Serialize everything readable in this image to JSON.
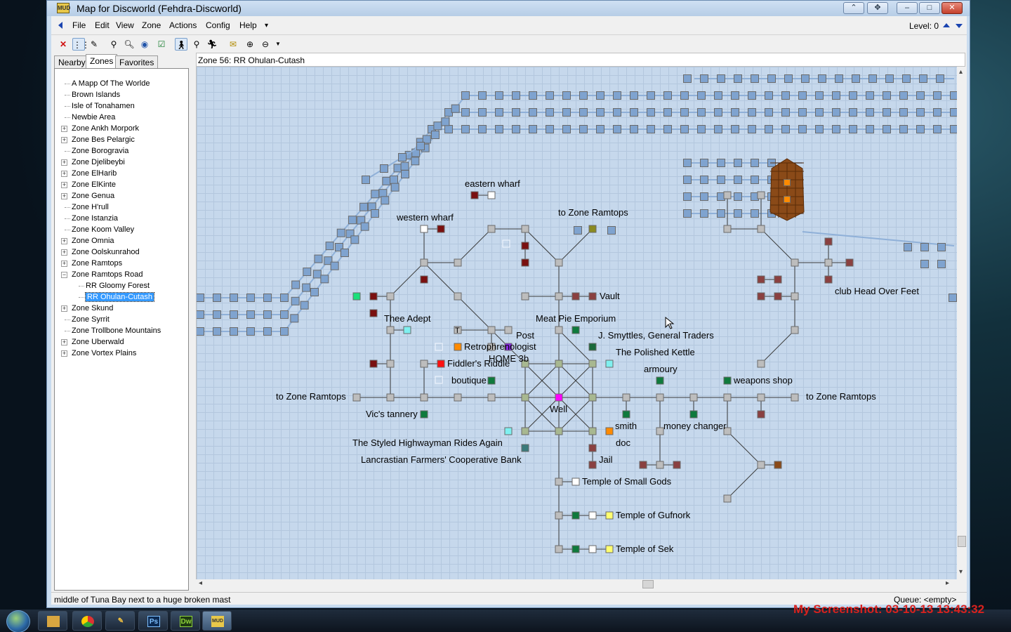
{
  "window": {
    "title": "Map for Discworld (Fehdra-Discworld)",
    "app_icon_text": "MUD"
  },
  "menu": [
    "File",
    "Edit",
    "View",
    "Zone",
    "Actions",
    "Config",
    "Help",
    "▾"
  ],
  "level": {
    "label": "Level: 0"
  },
  "panel_tabs": [
    "Nearby",
    "Zones",
    "Favorites"
  ],
  "zone_tree": [
    {
      "label": "A Mapp Of The Worlde",
      "expandable": false,
      "depth": 0
    },
    {
      "label": "Brown Islands",
      "expandable": false,
      "depth": 0
    },
    {
      "label": "Isle of Tonahamen",
      "expandable": false,
      "depth": 0
    },
    {
      "label": "Newbie Area",
      "expandable": false,
      "depth": 0
    },
    {
      "label": "Zone Ankh Morpork",
      "expandable": true,
      "depth": 0
    },
    {
      "label": "Zone Bes Pelargic",
      "expandable": true,
      "depth": 0
    },
    {
      "label": "Zone Borogravia",
      "expandable": false,
      "depth": 0
    },
    {
      "label": "Zone Djelibeybi",
      "expandable": true,
      "depth": 0
    },
    {
      "label": "Zone ElHarib",
      "expandable": true,
      "depth": 0
    },
    {
      "label": "Zone ElKinte",
      "expandable": true,
      "depth": 0
    },
    {
      "label": "Zone Genua",
      "expandable": true,
      "depth": 0
    },
    {
      "label": "Zone H'rull",
      "expandable": false,
      "depth": 0
    },
    {
      "label": "Zone Istanzia",
      "expandable": false,
      "depth": 0
    },
    {
      "label": "Zone Koom Valley",
      "expandable": false,
      "depth": 0
    },
    {
      "label": "Zone Omnia",
      "expandable": true,
      "depth": 0
    },
    {
      "label": "Zone Oolskunrahod",
      "expandable": true,
      "depth": 0
    },
    {
      "label": "Zone Ramtops",
      "expandable": true,
      "depth": 0
    },
    {
      "label": "Zone Ramtops Road",
      "expandable": true,
      "expanded": true,
      "depth": 0
    },
    {
      "label": "RR Gloomy Forest",
      "expandable": false,
      "depth": 1
    },
    {
      "label": "RR Ohulan-Cutash",
      "expandable": false,
      "depth": 1,
      "selected": true
    },
    {
      "label": "Zone Skund",
      "expandable": true,
      "depth": 0
    },
    {
      "label": "Zone Syrrit",
      "expandable": false,
      "depth": 0
    },
    {
      "label": "Zone Trollbone Mountains",
      "expandable": false,
      "depth": 0
    },
    {
      "label": "Zone Uberwald",
      "expandable": true,
      "depth": 0
    },
    {
      "label": "Zone Vortex Plains",
      "expandable": true,
      "depth": 0
    }
  ],
  "zone_header": "Zone 56: RR Ohulan-Cutash",
  "map_labels": [
    "eastern wharf",
    "western wharf",
    "to Zone Ramtops",
    "Vault",
    "club Head Over Feet",
    "Thee Adept",
    "Meat Pie Emporium",
    "Post",
    "J. Smyttles, General Traders",
    "Retrophrenologist",
    "HOME 3b",
    "The Polished Kettle",
    "Fiddler's Riddle",
    "armoury",
    "boutique",
    "weapons shop",
    "to Zone Ramtops",
    "to Zone Ramtops",
    "Well",
    "Vic's tannery",
    "smith",
    "money changer",
    "The Styled Highwayman Rides Again",
    "doc",
    "Lancrastian Farmers' Cooperative Bank",
    "Jail",
    "Temple of Small Gods",
    "Temple of Gufnork",
    "Temple of Sek"
  ],
  "status": {
    "text": "middle of Tuna Bay next to a huge broken mast",
    "queue": "Queue: <empty>"
  },
  "watermark": "My Screenshot: 03-10-13 13:43:32",
  "colors": {
    "map_bg": "#c6d8ec",
    "room_grey": "#bdbdbd",
    "water_room": "#7fa3cf",
    "shop_green": "#0f7a3c",
    "home_purple": "#8a2be2",
    "well_magenta": "#ff00ff"
  },
  "taskbar": [
    "explorer-icon",
    "chrome-icon",
    "pencil-icon",
    "photoshop-icon",
    "dreamweaver-icon",
    "mud-icon"
  ]
}
